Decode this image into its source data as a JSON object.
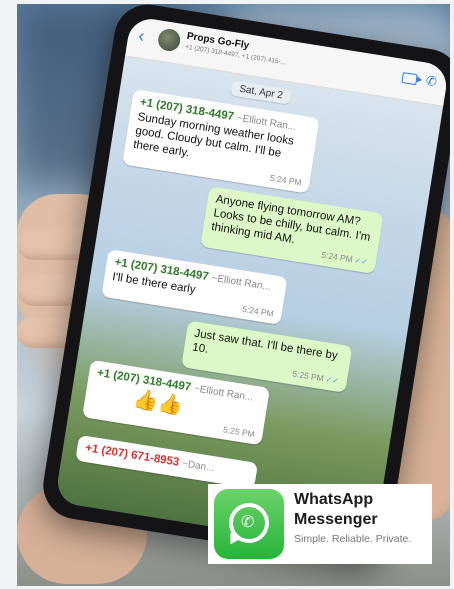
{
  "chat": {
    "group_name": "Props Go-Fly",
    "group_members": "+1 (207) 318-4497, +1 (207) 415-...",
    "date_chip": "Sat, Apr 2",
    "messages": [
      {
        "sender": "+1 (207) 318-4497",
        "alias": "~Elliott Ran...",
        "text": "Sunday morning weather looks good. Cloudy but calm. I'll be there early.",
        "time": "5:24 PM"
      },
      {
        "text": "Anyone flying tomorrow AM? Looks to be chilly, but calm. I'm thinking mid AM.",
        "time": "5:24 PM"
      },
      {
        "sender": "+1 (207) 318-4497",
        "alias": "~Elliott Ran...",
        "text": "I'll be there early",
        "time": "5:24 PM"
      },
      {
        "text": "Just saw that. I'll be there by 10.",
        "time": "5:25 PM"
      },
      {
        "sender": "+1 (207) 318-4497",
        "alias": "~Elliott Ran...",
        "text": "👍👍",
        "time": "5:25 PM"
      },
      {
        "sender": "+1 (207) 671-8953",
        "alias": "~Dan..."
      }
    ]
  },
  "badge": {
    "title_line1": "WhatsApp",
    "title_line2": "Messenger",
    "tagline": "Simple. Reliable. Private."
  },
  "icons": {
    "back": "chevron-left-icon",
    "video": "video-call-icon",
    "phone": "phone-call-icon",
    "logo": "whatsapp-logo-icon",
    "read_receipt": "double-check-icon"
  },
  "colors": {
    "sender_green": "#2f7a2a",
    "sender_red": "#d7322d",
    "outgoing_bubble": "#dcf8c6",
    "whatsapp_green": "#27b43a",
    "ios_blue": "#2a7de1"
  }
}
